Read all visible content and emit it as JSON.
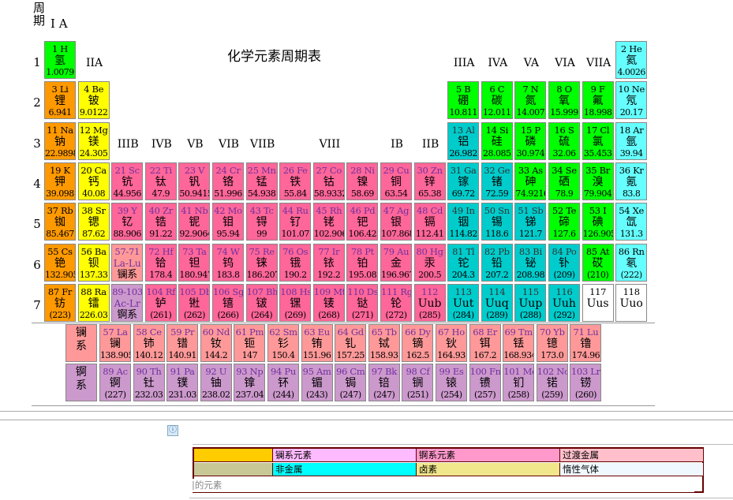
{
  "header": {
    "period_label": "周\n期",
    "group_1": "I A",
    "title": "化学元素周期表"
  },
  "group_labels": {
    "IIA": "IIA",
    "IIIA": "IIIA",
    "IVA": "IVA",
    "VA": "VA",
    "VIA": "VIA",
    "VIIA": "VIIA",
    "IIIB": "IIIB",
    "IVB": "IVB",
    "VB": "VB",
    "VIB": "VIB",
    "VIIB": "VIIB",
    "VIII": "VIII",
    "IB": "IB",
    "IIB": "IIB"
  },
  "periods": [
    "1",
    "2",
    "3",
    "4",
    "5",
    "6",
    "7"
  ],
  "colors": {
    "nonmetal": "#00ff00",
    "noble": "#66ffff",
    "alkali": "#ff9900",
    "alkaline": "#ffff00",
    "transition": "#ff6699",
    "metalloid": "#00cccc",
    "lanthanide": "#ff9999",
    "actinide": "#cc99cc",
    "unknown": "#ffffff"
  },
  "elements": [
    {
      "s": "1 H",
      "n": "氢",
      "w": "1.0079",
      "c": "nonmetal",
      "col": 1,
      "row": 1
    },
    {
      "s": "2 He",
      "n": "氦",
      "w": "4.0026",
      "c": "noble",
      "col": 18,
      "row": 1
    },
    {
      "s": "3 Li",
      "n": "锂",
      "w": "6.941",
      "c": "alkali",
      "col": 1,
      "row": 2
    },
    {
      "s": "4 Be",
      "n": "铍",
      "w": "9.0122",
      "c": "alkaline",
      "col": 2,
      "row": 2
    },
    {
      "s": "5 B",
      "n": "硼",
      "w": "10.811",
      "c": "nonmetal",
      "col": 13,
      "row": 2
    },
    {
      "s": "6 C",
      "n": "碳",
      "w": "12.011",
      "c": "nonmetal",
      "col": 14,
      "row": 2
    },
    {
      "s": "7 N",
      "n": "氮",
      "w": "14.007",
      "c": "nonmetal",
      "col": 15,
      "row": 2
    },
    {
      "s": "8 O",
      "n": "氧",
      "w": "15.999",
      "c": "nonmetal",
      "col": 16,
      "row": 2
    },
    {
      "s": "9 F",
      "n": "氟",
      "w": "18.998",
      "c": "nonmetal",
      "col": 17,
      "row": 2
    },
    {
      "s": "10 Ne",
      "n": "氖",
      "w": "20.17",
      "c": "noble",
      "col": 18,
      "row": 2
    },
    {
      "s": "11 Na",
      "n": "钠",
      "w": "22.9898",
      "c": "alkali",
      "col": 1,
      "row": 3
    },
    {
      "s": "12 Mg",
      "n": "镁",
      "w": "24.305",
      "c": "alkaline",
      "col": 2,
      "row": 3
    },
    {
      "s": "13 Al",
      "n": "铝",
      "w": "26.982",
      "c": "metalloid",
      "col": 13,
      "row": 3
    },
    {
      "s": "14 Si",
      "n": "硅",
      "w": "28.085",
      "c": "nonmetal",
      "col": 14,
      "row": 3
    },
    {
      "s": "15 P",
      "n": "磷",
      "w": "30.974",
      "c": "nonmetal",
      "col": 15,
      "row": 3
    },
    {
      "s": "16 S",
      "n": "硫",
      "w": "32.06",
      "c": "nonmetal",
      "col": 16,
      "row": 3
    },
    {
      "s": "17 Cl",
      "n": "氯",
      "w": "35.453",
      "c": "nonmetal",
      "col": 17,
      "row": 3
    },
    {
      "s": "18 Ar",
      "n": "氩",
      "w": "39.94",
      "c": "noble",
      "col": 18,
      "row": 3
    },
    {
      "s": "19 K",
      "n": "钾",
      "w": "39.098",
      "c": "alkali",
      "col": 1,
      "row": 4
    },
    {
      "s": "20 Ca",
      "n": "钙",
      "w": "40.08",
      "c": "alkaline",
      "col": 2,
      "row": 4
    },
    {
      "s": "21 Sc",
      "n": "钪",
      "w": "44.956",
      "c": "transition",
      "col": 3,
      "row": 4
    },
    {
      "s": "22 Ti",
      "n": "钛",
      "w": "47.9",
      "c": "transition",
      "col": 4,
      "row": 4
    },
    {
      "s": "23 V",
      "n": "钒",
      "w": "50.9415",
      "c": "transition",
      "col": 5,
      "row": 4
    },
    {
      "s": "24 Cr",
      "n": "铬",
      "w": "51.996",
      "c": "transition",
      "col": 6,
      "row": 4
    },
    {
      "s": "25 Mn",
      "n": "锰",
      "w": "54.938",
      "c": "transition",
      "col": 7,
      "row": 4
    },
    {
      "s": "26 Fe",
      "n": "铁",
      "w": "55.84",
      "c": "transition",
      "col": 8,
      "row": 4
    },
    {
      "s": "27 Co",
      "n": "钴",
      "w": "58.9332",
      "c": "transition",
      "col": 9,
      "row": 4
    },
    {
      "s": "28 Ni",
      "n": "镍",
      "w": "58.69",
      "c": "transition",
      "col": 10,
      "row": 4
    },
    {
      "s": "29 Cu",
      "n": "铜",
      "w": "63.54",
      "c": "transition",
      "col": 11,
      "row": 4
    },
    {
      "s": "30 Zn",
      "n": "锌",
      "w": "65.38",
      "c": "transition",
      "col": 12,
      "row": 4
    },
    {
      "s": "31 Ga",
      "n": "镓",
      "w": "69.72",
      "c": "metalloid",
      "col": 13,
      "row": 4
    },
    {
      "s": "32 Ge",
      "n": "锗",
      "w": "72.59",
      "c": "metalloid",
      "col": 14,
      "row": 4
    },
    {
      "s": "33 As",
      "n": "砷",
      "w": "74.9216",
      "c": "nonmetal",
      "col": 15,
      "row": 4
    },
    {
      "s": "34 Se",
      "n": "硒",
      "w": "78.9",
      "c": "nonmetal",
      "col": 16,
      "row": 4
    },
    {
      "s": "35 Br",
      "n": "溴",
      "w": "79.904",
      "c": "nonmetal",
      "col": 17,
      "row": 4
    },
    {
      "s": "36 Kr",
      "n": "氪",
      "w": "83.8",
      "c": "noble",
      "col": 18,
      "row": 4
    },
    {
      "s": "37 Rb",
      "n": "铷",
      "w": "85.467",
      "c": "alkali",
      "col": 1,
      "row": 5
    },
    {
      "s": "38 Sr",
      "n": "锶",
      "w": "87.62",
      "c": "alkaline",
      "col": 2,
      "row": 5
    },
    {
      "s": "39 Y",
      "n": "钇",
      "w": "88.906",
      "c": "transition",
      "col": 3,
      "row": 5
    },
    {
      "s": "40 Zr",
      "n": "锆",
      "w": "91.22",
      "c": "transition",
      "col": 4,
      "row": 5
    },
    {
      "s": "41 Nb",
      "n": "铌",
      "w": "92.9064",
      "c": "transition",
      "col": 5,
      "row": 5
    },
    {
      "s": "42 Mo",
      "n": "钼",
      "w": "95.94",
      "c": "transition",
      "col": 6,
      "row": 5
    },
    {
      "s": "43 Tc",
      "n": "锝",
      "w": "99",
      "c": "transition",
      "col": 7,
      "row": 5
    },
    {
      "s": "44 Ru",
      "n": "钌",
      "w": "101.07",
      "c": "transition",
      "col": 8,
      "row": 5
    },
    {
      "s": "45 Rh",
      "n": "铑",
      "w": "102.906",
      "c": "transition",
      "col": 9,
      "row": 5
    },
    {
      "s": "46 Pd",
      "n": "钯",
      "w": "106.42",
      "c": "transition",
      "col": 10,
      "row": 5
    },
    {
      "s": "47 Ag",
      "n": "银",
      "w": "107.868",
      "c": "transition",
      "col": 11,
      "row": 5
    },
    {
      "s": "48 Cd",
      "n": "镉",
      "w": "112.41",
      "c": "transition",
      "col": 12,
      "row": 5
    },
    {
      "s": "49 In",
      "n": "铟",
      "w": "114.82",
      "c": "metalloid",
      "col": 13,
      "row": 5
    },
    {
      "s": "50 Sn",
      "n": "锡",
      "w": "118.6",
      "c": "metalloid",
      "col": 14,
      "row": 5
    },
    {
      "s": "51 Sb",
      "n": "锑",
      "w": "121.7",
      "c": "metalloid",
      "col": 15,
      "row": 5
    },
    {
      "s": "52 Te",
      "n": "碲",
      "w": "127.6",
      "c": "nonmetal",
      "col": 16,
      "row": 5
    },
    {
      "s": "53 I",
      "n": "碘",
      "w": "126.905",
      "c": "nonmetal",
      "col": 17,
      "row": 5
    },
    {
      "s": "54 Xe",
      "n": "氙",
      "w": "131.3",
      "c": "noble",
      "col": 18,
      "row": 5
    },
    {
      "s": "55 Cs",
      "n": "铯",
      "w": "132.905",
      "c": "alkali",
      "col": 1,
      "row": 6
    },
    {
      "s": "56 Ba",
      "n": "钡",
      "w": "137.33",
      "c": "alkaline",
      "col": 2,
      "row": 6
    },
    {
      "s": "72 Hf",
      "n": "铪",
      "w": "178.4",
      "c": "transition",
      "col": 4,
      "row": 6
    },
    {
      "s": "73 Ta",
      "n": "钽",
      "w": "180.947",
      "c": "transition",
      "col": 5,
      "row": 6
    },
    {
      "s": "74 W",
      "n": "钨",
      "w": "183.8",
      "c": "transition",
      "col": 6,
      "row": 6
    },
    {
      "s": "75 Re",
      "n": "铼",
      "w": "186.207",
      "c": "transition",
      "col": 7,
      "row": 6
    },
    {
      "s": "76 Os",
      "n": "锇",
      "w": "190.2",
      "c": "transition",
      "col": 8,
      "row": 6
    },
    {
      "s": "77 Ir",
      "n": "铱",
      "w": "192.2",
      "c": "transition",
      "col": 9,
      "row": 6
    },
    {
      "s": "78 Pt",
      "n": "铂",
      "w": "195.08",
      "c": "transition",
      "col": 10,
      "row": 6
    },
    {
      "s": "79 Au",
      "n": "金",
      "w": "196.967",
      "c": "transition",
      "col": 11,
      "row": 6
    },
    {
      "s": "80 Hg",
      "n": "汞",
      "w": "200.5",
      "c": "transition",
      "col": 12,
      "row": 6
    },
    {
      "s": "81 Tl",
      "n": "铊",
      "w": "204.3",
      "c": "metalloid",
      "col": 13,
      "row": 6
    },
    {
      "s": "82 Pb",
      "n": "铅",
      "w": "207.2",
      "c": "metalloid",
      "col": 14,
      "row": 6
    },
    {
      "s": "83 Bi",
      "n": "铋",
      "w": "208.98",
      "c": "metalloid",
      "col": 15,
      "row": 6
    },
    {
      "s": "84 Po",
      "n": "钋",
      "w": "(209)",
      "c": "metalloid",
      "col": 16,
      "row": 6
    },
    {
      "s": "85 At",
      "n": "砹",
      "w": "(210)",
      "c": "nonmetal",
      "col": 17,
      "row": 6
    },
    {
      "s": "86 Rn",
      "n": "氡",
      "w": "(222)",
      "c": "noble",
      "col": 18,
      "row": 6
    },
    {
      "s": "87 Fr",
      "n": "钫",
      "w": "(223)",
      "c": "alkali",
      "col": 1,
      "row": 7
    },
    {
      "s": "88 Ra",
      "n": "镭",
      "w": "226.03",
      "c": "alkaline",
      "col": 2,
      "row": 7
    },
    {
      "s": "104 Rf",
      "n": "𬬻",
      "w": "(261)",
      "c": "transition",
      "col": 4,
      "row": 7
    },
    {
      "s": "105 Db",
      "n": "𬭊",
      "w": "(262)",
      "c": "transition",
      "col": 5,
      "row": 7
    },
    {
      "s": "106 Sg",
      "n": "𬭳",
      "w": "(266)",
      "c": "transition",
      "col": 6,
      "row": 7
    },
    {
      "s": "107 Bh",
      "n": "𬭛",
      "w": "(264)",
      "c": "transition",
      "col": 7,
      "row": 7
    },
    {
      "s": "108 Hs",
      "n": "𬭶",
      "w": "(269)",
      "c": "transition",
      "col": 8,
      "row": 7
    },
    {
      "s": "109 Mt",
      "n": "鿏",
      "w": "(268)",
      "c": "transition",
      "col": 9,
      "row": 7
    },
    {
      "s": "110 Ds",
      "n": "𫟼",
      "w": "(271)",
      "c": "transition",
      "col": 10,
      "row": 7
    },
    {
      "s": "111 Rg",
      "n": "𬬭",
      "w": "(272)",
      "c": "transition",
      "col": 11,
      "row": 7
    },
    {
      "s": "112",
      "n": "Uub",
      "w": "(285)",
      "c": "transition",
      "col": 12,
      "row": 7
    },
    {
      "s": "113",
      "n": "Uut",
      "w": "(284)",
      "c": "metalloid",
      "col": 13,
      "row": 7
    },
    {
      "s": "114",
      "n": "Uuq",
      "w": "(289)",
      "c": "metalloid",
      "col": 14,
      "row": 7
    },
    {
      "s": "115",
      "n": "Uup",
      "w": "(288)",
      "c": "metalloid",
      "col": 15,
      "row": 7
    },
    {
      "s": "116",
      "n": "Uuh",
      "w": "(292)",
      "c": "metalloid",
      "col": 16,
      "row": 7
    },
    {
      "s": "117",
      "n": "Uus",
      "w": "",
      "c": "unknown",
      "col": 17,
      "row": 7
    },
    {
      "s": "118",
      "n": "Uuo",
      "w": "",
      "c": "unknown",
      "col": 18,
      "row": 7
    }
  ],
  "series_cells": [
    {
      "s": "57-71",
      "n": "La-Lu",
      "w": "镧系",
      "c": "lanthanide",
      "col": 3,
      "row": 6
    },
    {
      "s": "89-103",
      "n": "Ac-Lr",
      "w": "锕系",
      "c": "actinide",
      "col": 3,
      "row": 7
    }
  ],
  "lanthanides_label": "镧\n系",
  "actinides_label": "锕\n系",
  "lanthanides": [
    {
      "s": "57 La",
      "n": "镧",
      "w": "138.905"
    },
    {
      "s": "58 Ce",
      "n": "铈",
      "w": "140.12"
    },
    {
      "s": "59 Pr",
      "n": "镨",
      "w": "140.91"
    },
    {
      "s": "60 Nd",
      "n": "钕",
      "w": "144.2"
    },
    {
      "s": "61 Pm",
      "n": "钷",
      "w": "147"
    },
    {
      "s": "62 Sm",
      "n": "钐",
      "w": "150.4"
    },
    {
      "s": "63 Eu",
      "n": "铕",
      "w": "151.96"
    },
    {
      "s": "64 Gd",
      "n": "钆",
      "w": "157.25"
    },
    {
      "s": "65 Tb",
      "n": "铽",
      "w": "158.93"
    },
    {
      "s": "66 Dy",
      "n": "镝",
      "w": "162.5"
    },
    {
      "s": "67 Ho",
      "n": "钬",
      "w": "164.93"
    },
    {
      "s": "68 Er",
      "n": "铒",
      "w": "167.2"
    },
    {
      "s": "69 Tm",
      "n": "铥",
      "w": "168.934"
    },
    {
      "s": "70 Yb",
      "n": "镱",
      "w": "173.0"
    },
    {
      "s": "71 Lu",
      "n": "镥",
      "w": "174.96"
    }
  ],
  "actinides": [
    {
      "s": "89 Ac",
      "n": "锕",
      "w": "(227)"
    },
    {
      "s": "90 Th",
      "n": "钍",
      "w": "232.03"
    },
    {
      "s": "91 Pa",
      "n": "镤",
      "w": "231.03"
    },
    {
      "s": "92 U",
      "n": "铀",
      "w": "238.02"
    },
    {
      "s": "93 Np",
      "n": "镎",
      "w": "237.04"
    },
    {
      "s": "94 Pu",
      "n": "钚",
      "w": "(244)"
    },
    {
      "s": "95 Am",
      "n": "镅",
      "w": "(243)"
    },
    {
      "s": "96 Cm",
      "n": "锔",
      "w": "(247)"
    },
    {
      "s": "97 Bk",
      "n": "锫",
      "w": "(247)"
    },
    {
      "s": "98 Cf",
      "n": "锎",
      "w": "(251)"
    },
    {
      "s": "99 Es",
      "n": "锿",
      "w": "(254)"
    },
    {
      "s": "100 Fm",
      "n": "镄",
      "w": "(257)"
    },
    {
      "s": "101 Md",
      "n": "钔",
      "w": "(258)"
    },
    {
      "s": "102 No",
      "n": "锘",
      "w": "(259)"
    },
    {
      "s": "103 Lr",
      "n": "铹",
      "w": "(260)"
    }
  ],
  "legend": {
    "row1": [
      {
        "label": "",
        "color": "#ffcc00"
      },
      {
        "label": "镧系元素",
        "color": "#ffbbff"
      },
      {
        "label": "锕系元素",
        "color": "#ff99cc"
      },
      {
        "label": "过渡金属",
        "color": "#ffc0cb"
      }
    ],
    "row2": [
      {
        "label": "",
        "color": "#c8c896"
      },
      {
        "label": "非金属",
        "color": "#00ffff"
      },
      {
        "label": "卤素",
        "color": "#f0e68c"
      },
      {
        "label": "惰性气体",
        "color": "#f0f8ff"
      }
    ],
    "row3": [
      {
        "label": "|的元素",
        "color": "#ffffff"
      }
    ]
  }
}
